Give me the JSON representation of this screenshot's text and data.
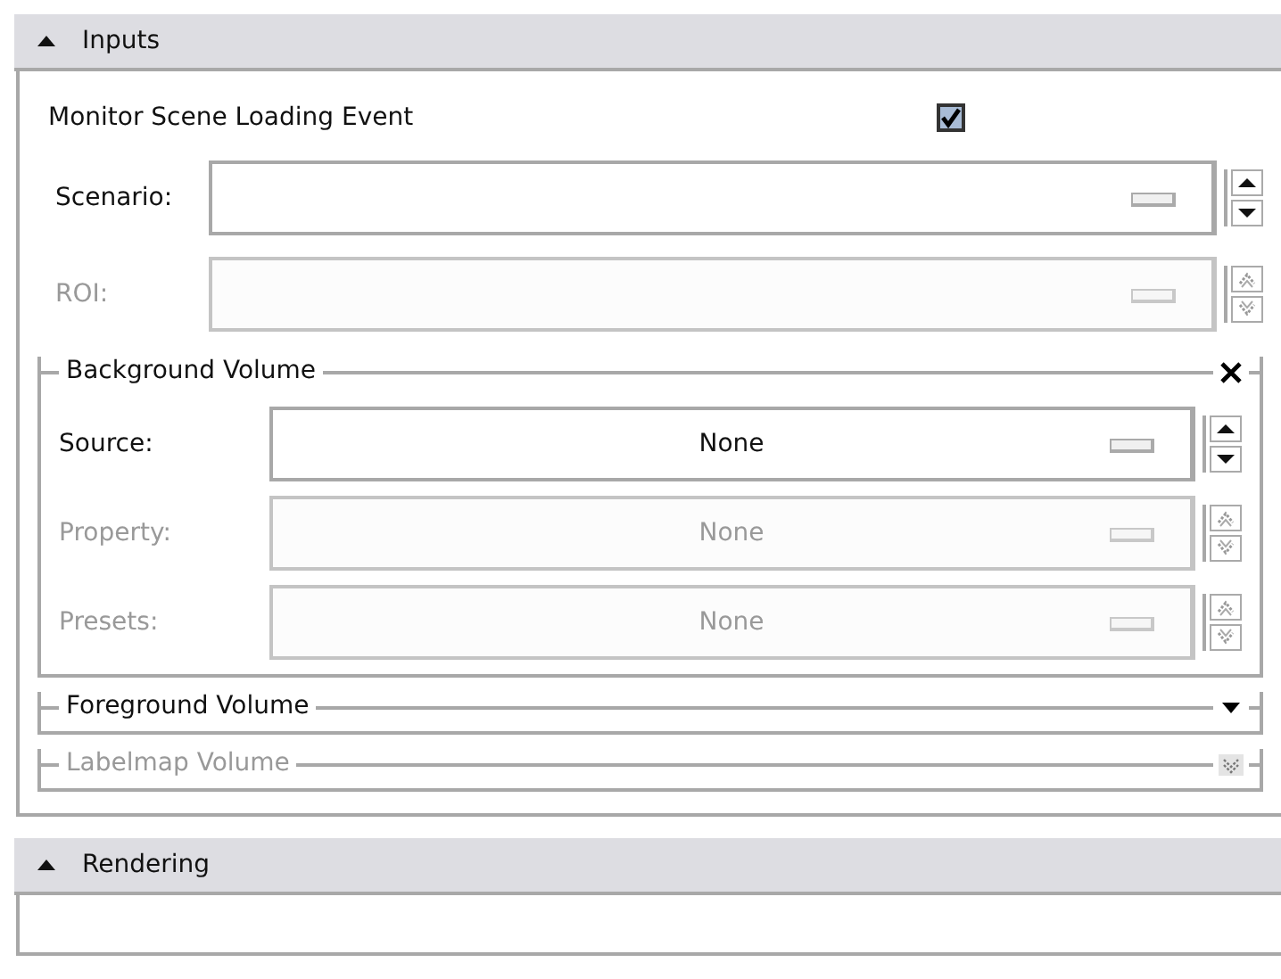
{
  "sections": [
    {
      "title": "Inputs",
      "expanded": true,
      "checkbox": {
        "label": "Monitor Scene Loading Event",
        "checked": true
      },
      "selectors": [
        {
          "label": "Scenario:",
          "disabled": false
        },
        {
          "label": "ROI:",
          "disabled": true
        }
      ],
      "groups": [
        {
          "title": "Background Volume",
          "expanded": true,
          "disabled": false,
          "selectors": [
            {
              "label": "Source:",
              "value": "None",
              "disabled": false
            },
            {
              "label": "Property:",
              "value": "None",
              "disabled": true
            },
            {
              "label": "Presets:",
              "value": "None",
              "disabled": true
            }
          ]
        },
        {
          "title": "Foreground Volume",
          "expanded": false,
          "disabled": false
        },
        {
          "title": "Labelmap Volume",
          "expanded": false,
          "disabled": true
        }
      ]
    },
    {
      "title": "Rendering",
      "expanded": true
    }
  ]
}
